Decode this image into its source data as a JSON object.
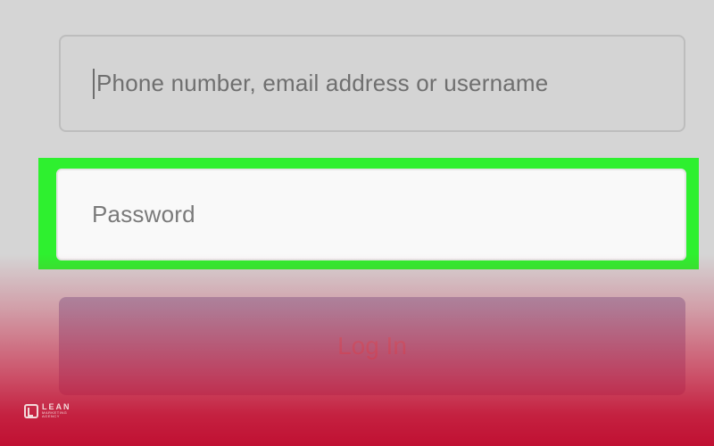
{
  "login_form": {
    "username_placeholder": "Phone number, email address or username",
    "password_placeholder": "Password",
    "login_button_label": "Log In"
  },
  "highlight": {
    "color": "#2ef02f",
    "target": "password-field"
  },
  "overlay": {
    "color": "#c01032"
  },
  "watermark": {
    "brand": "LEAN",
    "tagline": "MARKETING AGENCY"
  }
}
